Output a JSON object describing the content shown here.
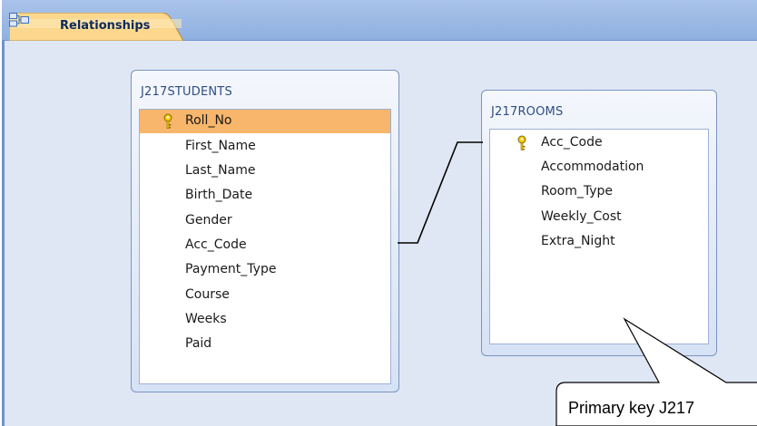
{
  "tab": {
    "label": "Relationships",
    "icon": "relationships-icon"
  },
  "tables": [
    {
      "name": "J217STUDENTS",
      "fields": [
        {
          "label": "Roll_No",
          "primary_key": true,
          "selected": true
        },
        {
          "label": "First_Name",
          "primary_key": false,
          "selected": false
        },
        {
          "label": "Last_Name",
          "primary_key": false,
          "selected": false
        },
        {
          "label": "Birth_Date",
          "primary_key": false,
          "selected": false
        },
        {
          "label": "Gender",
          "primary_key": false,
          "selected": false
        },
        {
          "label": "Acc_Code",
          "primary_key": false,
          "selected": false
        },
        {
          "label": "Payment_Type",
          "primary_key": false,
          "selected": false
        },
        {
          "label": "Course",
          "primary_key": false,
          "selected": false
        },
        {
          "label": "Weeks",
          "primary_key": false,
          "selected": false
        },
        {
          "label": "Paid",
          "primary_key": false,
          "selected": false
        }
      ]
    },
    {
      "name": "J217ROOMS",
      "fields": [
        {
          "label": "Acc_Code",
          "primary_key": true,
          "selected": false
        },
        {
          "label": "Accommodation",
          "primary_key": false,
          "selected": false
        },
        {
          "label": "Room_Type",
          "primary_key": false,
          "selected": false
        },
        {
          "label": "Weekly_Cost",
          "primary_key": false,
          "selected": false
        },
        {
          "label": "Extra_Night",
          "primary_key": false,
          "selected": false
        }
      ]
    }
  ],
  "callout": {
    "text": "Primary key J217"
  },
  "colors": {
    "selected_row": "#f7b66b",
    "tab_bar": "#9db9e6",
    "canvas": "#dfe7f5"
  }
}
